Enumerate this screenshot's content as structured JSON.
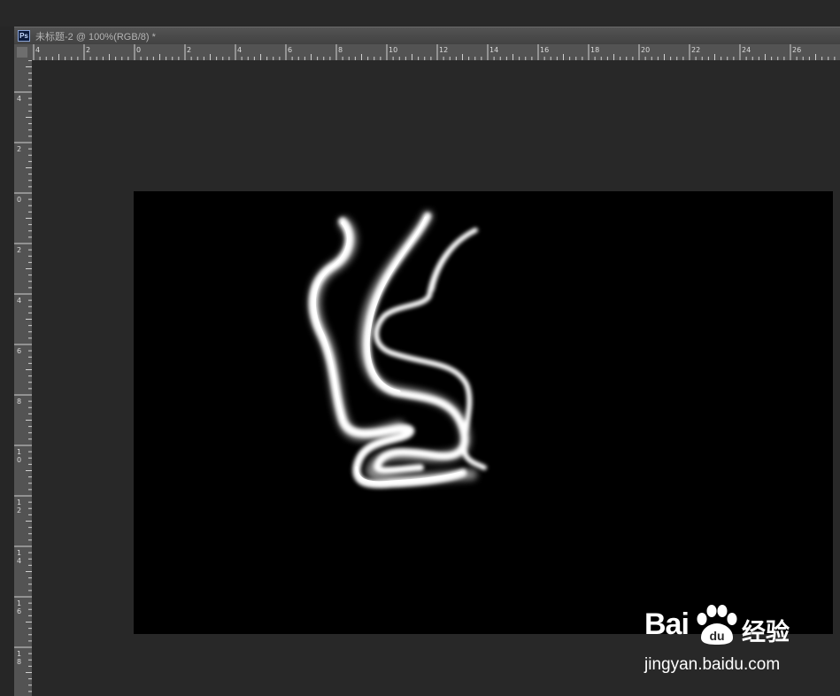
{
  "document": {
    "app_badge": "Ps",
    "tab_title": "未标题-2 @ 100%(RGB/8) *"
  },
  "rulers": {
    "unit_spacing": "cm",
    "horizontal_labels": [
      "4",
      "2",
      "0",
      "2",
      "4",
      "6",
      "8",
      "10",
      "12",
      "14",
      "16",
      "18",
      "20",
      "22",
      "24",
      "26"
    ],
    "vertical_labels": [
      "4",
      "2",
      "0",
      "2",
      "4",
      "6",
      "8",
      "10",
      "12",
      "14",
      "16",
      "18"
    ]
  },
  "canvas": {
    "background_color": "#000000",
    "stroke_color": "#ffffff",
    "content": "glowing-white-brush-strokes"
  },
  "watermark": {
    "logo_text_left": "Bai",
    "logo_text_right": "经验",
    "logo_icon": "paw-du-icon",
    "url": "jingyan.baidu.com"
  },
  "colors": {
    "workspace": "#282828",
    "ruler": "#535353",
    "titlebar": "#4a4a4a"
  }
}
